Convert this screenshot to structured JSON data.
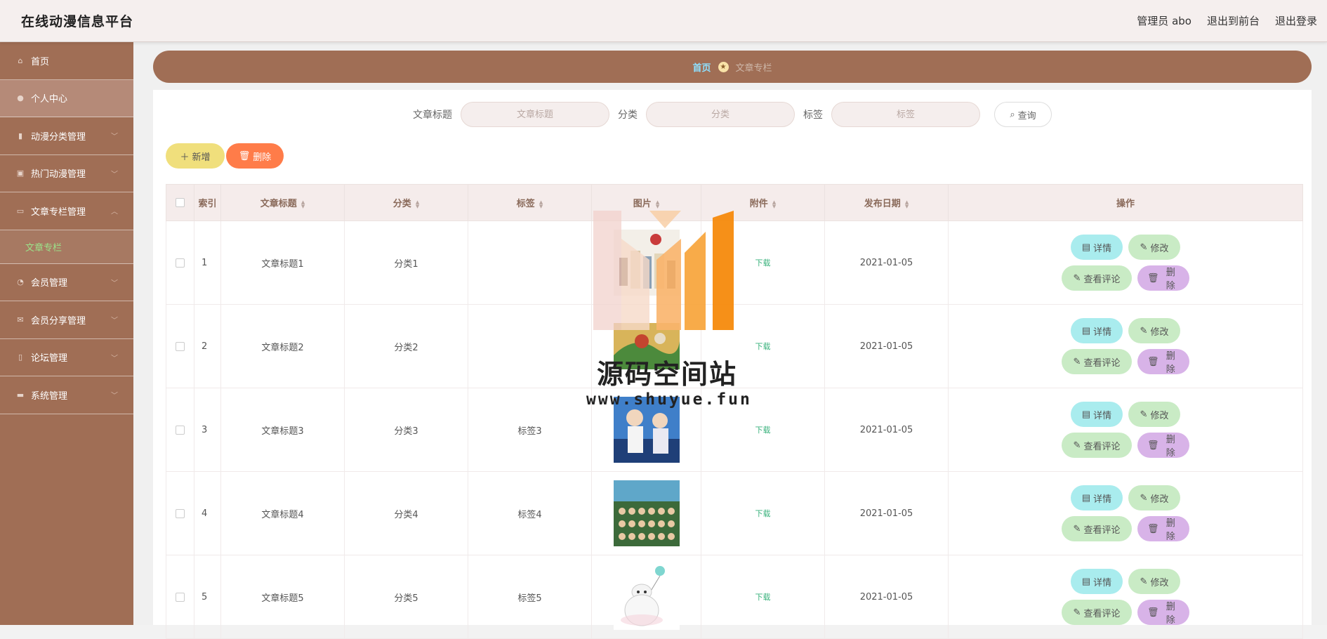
{
  "app": {
    "title": "在线动漫信息平台",
    "user": "管理员 abo",
    "to_front": "退出到前台",
    "logout": "退出登录"
  },
  "sidebar": {
    "items": [
      {
        "label": "首页",
        "icon": "home-icon"
      },
      {
        "label": "个人中心",
        "icon": "user-icon",
        "active": true
      },
      {
        "label": "动漫分类管理",
        "icon": "tag-icon"
      },
      {
        "label": "热门动漫管理",
        "icon": "clipboard-icon"
      },
      {
        "label": "文章专栏管理",
        "icon": "article-icon",
        "expanded": true
      },
      {
        "label": "会员管理",
        "icon": "compass-icon"
      },
      {
        "label": "会员分享管理",
        "icon": "mail-icon"
      },
      {
        "label": "论坛管理",
        "icon": "bulb-icon"
      },
      {
        "label": "系统管理",
        "icon": "keyboard-icon"
      }
    ],
    "sub_item": "文章专栏"
  },
  "breadcrumb": {
    "home": "首页",
    "current": "文章专栏"
  },
  "search": {
    "title_label": "文章标题",
    "title_placeholder": "文章标题",
    "category_label": "分类",
    "category_placeholder": "分类",
    "tag_label": "标签",
    "tag_placeholder": "标签",
    "query_button": "查询"
  },
  "actions": {
    "add": "新增",
    "delete": "删除"
  },
  "table": {
    "columns": [
      "索引",
      "文章标题",
      "分类",
      "标签",
      "图片",
      "附件",
      "发布日期",
      "操作"
    ],
    "rows": [
      {
        "index": "1",
        "title": "文章标题1",
        "category": "分类1",
        "tag": "",
        "attachment": "下载",
        "date": "2021-01-05"
      },
      {
        "index": "2",
        "title": "文章标题2",
        "category": "分类2",
        "tag": "",
        "attachment": "下载",
        "date": "2021-01-05"
      },
      {
        "index": "3",
        "title": "文章标题3",
        "category": "分类3",
        "tag": "标签3",
        "attachment": "下载",
        "date": "2021-01-05"
      },
      {
        "index": "4",
        "title": "文章标题4",
        "category": "分类4",
        "tag": "标签4",
        "attachment": "下载",
        "date": "2021-01-05"
      },
      {
        "index": "5",
        "title": "文章标题5",
        "category": "分类5",
        "tag": "标签5",
        "attachment": "下载",
        "date": "2021-01-05"
      }
    ],
    "op_labels": {
      "detail": "详情",
      "edit": "修改",
      "comments": "查看评论",
      "remove": "删除"
    }
  },
  "watermark": {
    "name": "源码空间站",
    "url": "www.shuyue.fun"
  },
  "colors": {
    "sidebar_bg": "#a06e55",
    "header_bg": "#f5efee",
    "active_menu": "#b58a78",
    "submenu_text": "#9be38a",
    "add_button": "#f0df7c",
    "delete_button": "#ff7c49",
    "detail_button": "#a9ecee",
    "edit_button": "#c9ebc5",
    "remove_button": "#d8b3e8"
  }
}
